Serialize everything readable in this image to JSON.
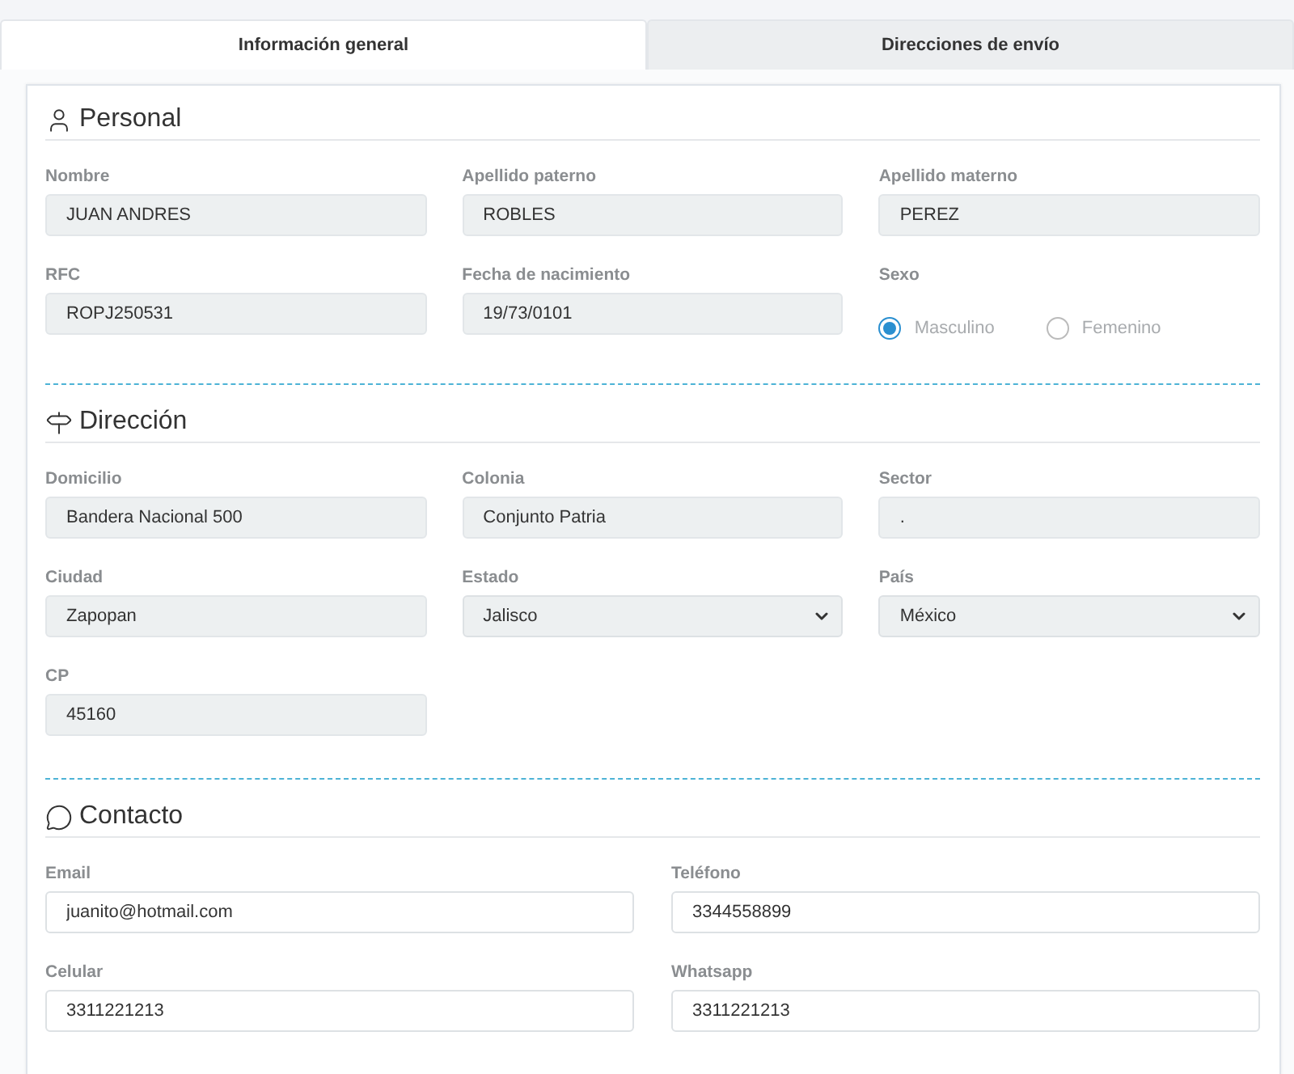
{
  "tabs": [
    {
      "label": "Información general",
      "selected": true
    },
    {
      "label": "Direcciones de envío",
      "selected": false
    }
  ],
  "sections": [
    {
      "title": "Personal",
      "fields": [
        {
          "kind": "text",
          "label": "Nombre",
          "value": "JUAN ANDRES",
          "readonly": true
        },
        {
          "kind": "text",
          "label": "Apellido paterno",
          "value": "ROBLES",
          "readonly": true
        },
        {
          "kind": "text",
          "label": "Apellido materno",
          "value": "PEREZ",
          "readonly": true
        },
        {
          "kind": "text",
          "label": "RFC",
          "value": "ROPJ250531",
          "readonly": true
        },
        {
          "kind": "text",
          "label": "Fecha de nacimiento",
          "value": "19/73/0101",
          "readonly": true
        },
        {
          "kind": "radio",
          "label": "Sexo",
          "disabled": true,
          "options": [
            {
              "label": "Masculino",
              "selected": true
            },
            {
              "label": "Femenino",
              "selected": false
            }
          ]
        }
      ]
    },
    {
      "title": "Dirección",
      "fields": [
        {
          "kind": "text",
          "label": "Domicilio",
          "value": "Bandera Nacional 500",
          "readonly": true
        },
        {
          "kind": "text",
          "label": "Colonia",
          "value": "Conjunto Patria",
          "readonly": true
        },
        {
          "kind": "text",
          "label": "Sector",
          "value": ".",
          "readonly": true
        },
        {
          "kind": "text",
          "label": "Ciudad",
          "value": "Zapopan",
          "readonly": true
        },
        {
          "kind": "select",
          "label": "Estado",
          "value": "Jalisco",
          "readonly": true
        },
        {
          "kind": "select",
          "label": "País",
          "value": "México",
          "readonly": true
        },
        {
          "kind": "text",
          "label": "CP",
          "value": "45160",
          "readonly": true
        }
      ]
    },
    {
      "title": "Contacto",
      "fields": [
        {
          "kind": "text",
          "label": "Email",
          "value": "juanito@hotmail.com",
          "readonly": false
        },
        {
          "kind": "text",
          "label": "Teléfono",
          "value": "3344558899",
          "readonly": false
        },
        {
          "kind": "text",
          "label": "Celular",
          "value": "3311221213",
          "readonly": false
        },
        {
          "kind": "text",
          "label": "Whatsapp",
          "value": "3311221213",
          "readonly": false
        }
      ]
    }
  ]
}
